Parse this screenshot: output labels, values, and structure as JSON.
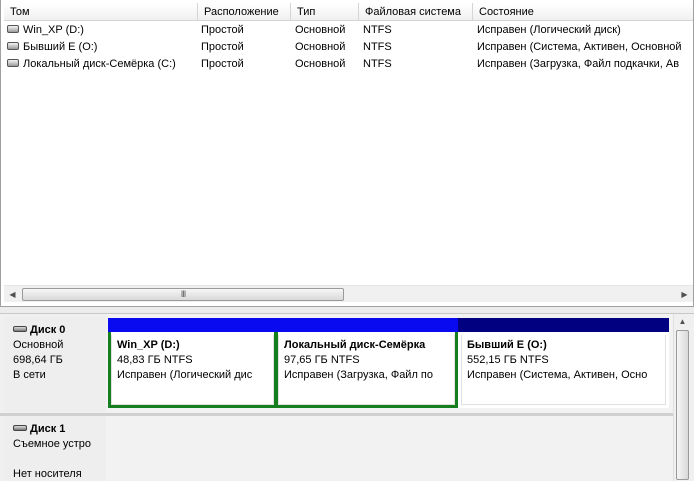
{
  "volume_list": {
    "columns": [
      "Том",
      "Расположение",
      "Тип",
      "Файловая система",
      "Состояние"
    ],
    "rows": [
      {
        "name": "Win_XP (D:)",
        "layout": "Простой",
        "type": "Основной",
        "fs": "NTFS",
        "status": "Исправен (Логический диск)"
      },
      {
        "name": "Бывший Е (O:)",
        "layout": "Простой",
        "type": "Основной",
        "fs": "NTFS",
        "status": "Исправен (Система, Активен, Основной"
      },
      {
        "name": "Локальный диск-Семёрка (C:)",
        "layout": "Простой",
        "type": "Основной",
        "fs": "NTFS",
        "status": "Исправен (Загрузка, Файл подкачки, Ав"
      }
    ],
    "hscroll_grip": "III"
  },
  "disks": [
    {
      "name": "Диск 0",
      "kind": "Основной",
      "size": "698,64 ГБ",
      "state": "В сети",
      "volumes": [
        {
          "title": "Win_XP  (D:)",
          "size": "48,83 ГБ NTFS",
          "status": "Исправен (Логический дис",
          "bar_color": "#0a0af0"
        },
        {
          "title": "Локальный диск-Семёрка",
          "size": "97,65 ГБ NTFS",
          "status": "Исправен (Загрузка, Файл по",
          "bar_color": "#0a0af0"
        },
        {
          "title": "Бывший Е  (O:)",
          "size": "552,15 ГБ NTFS",
          "status": "Исправен (Система, Активен, Осно",
          "bar_color": "#000080"
        }
      ]
    },
    {
      "name": "Диск 1",
      "kind": "Съемное устро",
      "state": "Нет носителя"
    }
  ],
  "colors": {
    "selection_outline": "#157f1f",
    "primary_partition": "#0a0af0",
    "primary_partition_dark": "#000080"
  }
}
